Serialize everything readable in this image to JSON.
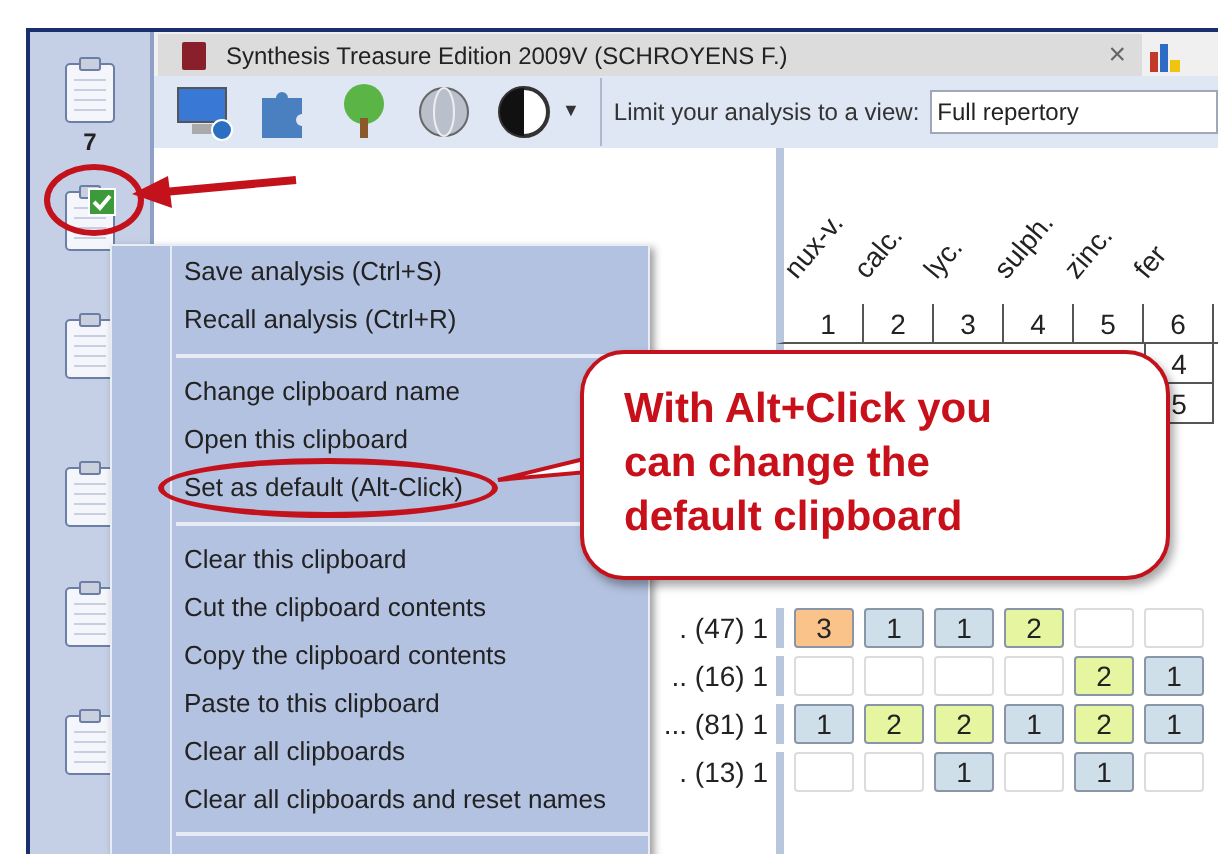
{
  "sidebar": {
    "clipboards": [
      {
        "label": "7",
        "default": false
      },
      {
        "default": true
      },
      {
        "default": false
      },
      {
        "default": false
      },
      {
        "default": false
      },
      {
        "default": false
      }
    ]
  },
  "tab": {
    "title": "Synthesis Treasure Edition 2009V (SCHROYENS F.)",
    "close": "×"
  },
  "toolbar": {
    "dropdown_caret": "▼",
    "view_label": "Limit your analysis to a view:",
    "view_select": {
      "value": "Full repertory"
    }
  },
  "grid": {
    "remedies": [
      "nux-v.",
      "calc.",
      "lyc.",
      "sulph.",
      "zinc.",
      "fer"
    ],
    "column_numbers": [
      "1",
      "2",
      "3",
      "4",
      "5",
      "6"
    ],
    "last_column_totals": [
      "4",
      "5"
    ],
    "rows": [
      {
        "label": ". (47) 1",
        "cells": [
          {
            "value": "3",
            "color": "#f9c38a"
          },
          {
            "value": "1",
            "color": "#cfdfea"
          },
          {
            "value": "1",
            "color": "#cfdfea"
          },
          {
            "value": "2",
            "color": "#e6f5a0"
          },
          null,
          null
        ]
      },
      {
        "label": ".. (16) 1",
        "cells": [
          null,
          null,
          null,
          null,
          {
            "value": "2",
            "color": "#e6f5a0"
          },
          {
            "value": "1",
            "color": "#cfdfea"
          }
        ]
      },
      {
        "label": "... (81) 1",
        "cells": [
          {
            "value": "1",
            "color": "#cfdfea"
          },
          {
            "value": "2",
            "color": "#e6f5a0"
          },
          {
            "value": "2",
            "color": "#e6f5a0"
          },
          {
            "value": "1",
            "color": "#cfdfea"
          },
          {
            "value": "2",
            "color": "#e6f5a0"
          },
          {
            "value": "1",
            "color": "#cfdfea"
          }
        ]
      },
      {
        "label": ". (13) 1",
        "cells": [
          null,
          null,
          {
            "value": "1",
            "color": "#cfdfea"
          },
          null,
          {
            "value": "1",
            "color": "#cfdfea"
          },
          null
        ]
      }
    ]
  },
  "context_menu": {
    "groups": [
      [
        {
          "label": "Save analysis (Ctrl+S)"
        },
        {
          "label": "Recall analysis (Ctrl+R)"
        }
      ],
      [
        {
          "label": "Change clipboard name"
        },
        {
          "label": "Open this clipboard"
        },
        {
          "label": "Set as default (Alt-Click)",
          "highlighted": true
        }
      ],
      [
        {
          "label": "Clear this clipboard"
        },
        {
          "label": "Cut the clipboard contents"
        },
        {
          "label": "Copy the clipboard contents"
        },
        {
          "label": "Paste to this clipboard"
        },
        {
          "label": "Clear all clipboards"
        },
        {
          "label": "Clear all clipboards and reset names"
        }
      ]
    ]
  },
  "callout": {
    "text": "With Alt+Click you can change the default clipboard"
  }
}
